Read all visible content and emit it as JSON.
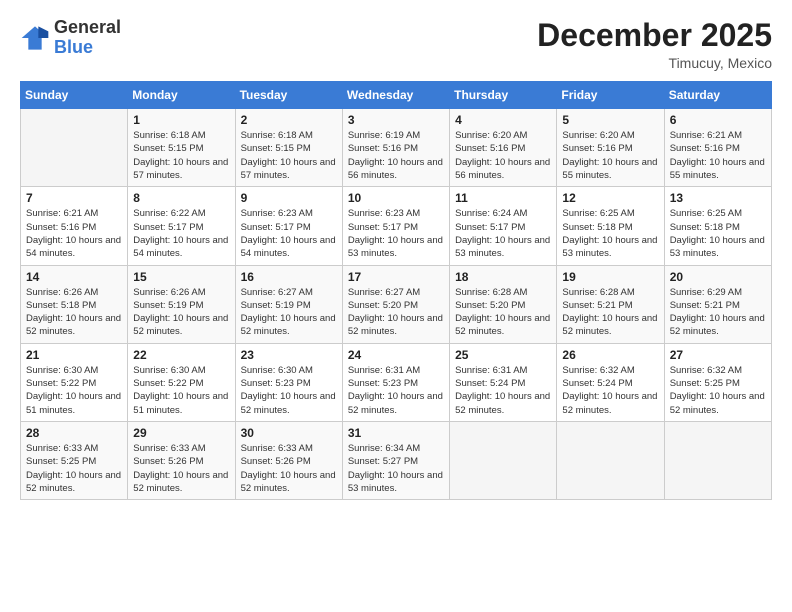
{
  "logo": {
    "general": "General",
    "blue": "Blue"
  },
  "title": {
    "month_year": "December 2025",
    "location": "Timucuy, Mexico"
  },
  "days_of_week": [
    "Sunday",
    "Monday",
    "Tuesday",
    "Wednesday",
    "Thursday",
    "Friday",
    "Saturday"
  ],
  "weeks": [
    [
      {
        "day": "",
        "sunrise": "",
        "sunset": "",
        "daylight": ""
      },
      {
        "day": "1",
        "sunrise": "Sunrise: 6:18 AM",
        "sunset": "Sunset: 5:15 PM",
        "daylight": "Daylight: 10 hours and 57 minutes."
      },
      {
        "day": "2",
        "sunrise": "Sunrise: 6:18 AM",
        "sunset": "Sunset: 5:15 PM",
        "daylight": "Daylight: 10 hours and 57 minutes."
      },
      {
        "day": "3",
        "sunrise": "Sunrise: 6:19 AM",
        "sunset": "Sunset: 5:16 PM",
        "daylight": "Daylight: 10 hours and 56 minutes."
      },
      {
        "day": "4",
        "sunrise": "Sunrise: 6:20 AM",
        "sunset": "Sunset: 5:16 PM",
        "daylight": "Daylight: 10 hours and 56 minutes."
      },
      {
        "day": "5",
        "sunrise": "Sunrise: 6:20 AM",
        "sunset": "Sunset: 5:16 PM",
        "daylight": "Daylight: 10 hours and 55 minutes."
      },
      {
        "day": "6",
        "sunrise": "Sunrise: 6:21 AM",
        "sunset": "Sunset: 5:16 PM",
        "daylight": "Daylight: 10 hours and 55 minutes."
      }
    ],
    [
      {
        "day": "7",
        "sunrise": "Sunrise: 6:21 AM",
        "sunset": "Sunset: 5:16 PM",
        "daylight": "Daylight: 10 hours and 54 minutes."
      },
      {
        "day": "8",
        "sunrise": "Sunrise: 6:22 AM",
        "sunset": "Sunset: 5:17 PM",
        "daylight": "Daylight: 10 hours and 54 minutes."
      },
      {
        "day": "9",
        "sunrise": "Sunrise: 6:23 AM",
        "sunset": "Sunset: 5:17 PM",
        "daylight": "Daylight: 10 hours and 54 minutes."
      },
      {
        "day": "10",
        "sunrise": "Sunrise: 6:23 AM",
        "sunset": "Sunset: 5:17 PM",
        "daylight": "Daylight: 10 hours and 53 minutes."
      },
      {
        "day": "11",
        "sunrise": "Sunrise: 6:24 AM",
        "sunset": "Sunset: 5:17 PM",
        "daylight": "Daylight: 10 hours and 53 minutes."
      },
      {
        "day": "12",
        "sunrise": "Sunrise: 6:25 AM",
        "sunset": "Sunset: 5:18 PM",
        "daylight": "Daylight: 10 hours and 53 minutes."
      },
      {
        "day": "13",
        "sunrise": "Sunrise: 6:25 AM",
        "sunset": "Sunset: 5:18 PM",
        "daylight": "Daylight: 10 hours and 53 minutes."
      }
    ],
    [
      {
        "day": "14",
        "sunrise": "Sunrise: 6:26 AM",
        "sunset": "Sunset: 5:18 PM",
        "daylight": "Daylight: 10 hours and 52 minutes."
      },
      {
        "day": "15",
        "sunrise": "Sunrise: 6:26 AM",
        "sunset": "Sunset: 5:19 PM",
        "daylight": "Daylight: 10 hours and 52 minutes."
      },
      {
        "day": "16",
        "sunrise": "Sunrise: 6:27 AM",
        "sunset": "Sunset: 5:19 PM",
        "daylight": "Daylight: 10 hours and 52 minutes."
      },
      {
        "day": "17",
        "sunrise": "Sunrise: 6:27 AM",
        "sunset": "Sunset: 5:20 PM",
        "daylight": "Daylight: 10 hours and 52 minutes."
      },
      {
        "day": "18",
        "sunrise": "Sunrise: 6:28 AM",
        "sunset": "Sunset: 5:20 PM",
        "daylight": "Daylight: 10 hours and 52 minutes."
      },
      {
        "day": "19",
        "sunrise": "Sunrise: 6:28 AM",
        "sunset": "Sunset: 5:21 PM",
        "daylight": "Daylight: 10 hours and 52 minutes."
      },
      {
        "day": "20",
        "sunrise": "Sunrise: 6:29 AM",
        "sunset": "Sunset: 5:21 PM",
        "daylight": "Daylight: 10 hours and 52 minutes."
      }
    ],
    [
      {
        "day": "21",
        "sunrise": "Sunrise: 6:30 AM",
        "sunset": "Sunset: 5:22 PM",
        "daylight": "Daylight: 10 hours and 51 minutes."
      },
      {
        "day": "22",
        "sunrise": "Sunrise: 6:30 AM",
        "sunset": "Sunset: 5:22 PM",
        "daylight": "Daylight: 10 hours and 51 minutes."
      },
      {
        "day": "23",
        "sunrise": "Sunrise: 6:30 AM",
        "sunset": "Sunset: 5:23 PM",
        "daylight": "Daylight: 10 hours and 52 minutes."
      },
      {
        "day": "24",
        "sunrise": "Sunrise: 6:31 AM",
        "sunset": "Sunset: 5:23 PM",
        "daylight": "Daylight: 10 hours and 52 minutes."
      },
      {
        "day": "25",
        "sunrise": "Sunrise: 6:31 AM",
        "sunset": "Sunset: 5:24 PM",
        "daylight": "Daylight: 10 hours and 52 minutes."
      },
      {
        "day": "26",
        "sunrise": "Sunrise: 6:32 AM",
        "sunset": "Sunset: 5:24 PM",
        "daylight": "Daylight: 10 hours and 52 minutes."
      },
      {
        "day": "27",
        "sunrise": "Sunrise: 6:32 AM",
        "sunset": "Sunset: 5:25 PM",
        "daylight": "Daylight: 10 hours and 52 minutes."
      }
    ],
    [
      {
        "day": "28",
        "sunrise": "Sunrise: 6:33 AM",
        "sunset": "Sunset: 5:25 PM",
        "daylight": "Daylight: 10 hours and 52 minutes."
      },
      {
        "day": "29",
        "sunrise": "Sunrise: 6:33 AM",
        "sunset": "Sunset: 5:26 PM",
        "daylight": "Daylight: 10 hours and 52 minutes."
      },
      {
        "day": "30",
        "sunrise": "Sunrise: 6:33 AM",
        "sunset": "Sunset: 5:26 PM",
        "daylight": "Daylight: 10 hours and 52 minutes."
      },
      {
        "day": "31",
        "sunrise": "Sunrise: 6:34 AM",
        "sunset": "Sunset: 5:27 PM",
        "daylight": "Daylight: 10 hours and 53 minutes."
      },
      {
        "day": "",
        "sunrise": "",
        "sunset": "",
        "daylight": ""
      },
      {
        "day": "",
        "sunrise": "",
        "sunset": "",
        "daylight": ""
      },
      {
        "day": "",
        "sunrise": "",
        "sunset": "",
        "daylight": ""
      }
    ]
  ]
}
